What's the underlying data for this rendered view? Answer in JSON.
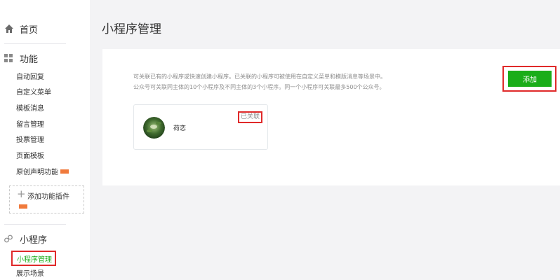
{
  "sidebar": {
    "home_label": "首页",
    "function_section": {
      "title": "功能",
      "items": [
        "自动回复",
        "自定义菜单",
        "模板消息",
        "留言管理",
        "投票管理",
        "页面模板",
        "原创声明功能"
      ],
      "add_plugin_label": "添加功能插件"
    },
    "miniprogram_section": {
      "title": "小程序",
      "items": [
        "小程序管理",
        "展示场景"
      ]
    }
  },
  "main": {
    "page_title": "小程序管理",
    "description_line1": "可关联已有的小程序或快速创建小程序。已关联的小程序可被使用在自定义菜单和模版消息等场景中。",
    "description_line2": "公众号可关联同主体的10个小程序及不同主体的3个小程序。同一个小程序可关联最多500个公众号。",
    "add_button_label": "添加",
    "miniprogram": {
      "name": "荷恋",
      "status": "已关联"
    }
  },
  "colors": {
    "accent_green": "#1aad19",
    "highlight_red": "#e02a2a",
    "new_badge": "#f07a3c"
  },
  "icons": {
    "home": "home-icon",
    "function": "grid-icon",
    "miniprogram": "miniprogram-icon",
    "plus": "plus-icon"
  }
}
